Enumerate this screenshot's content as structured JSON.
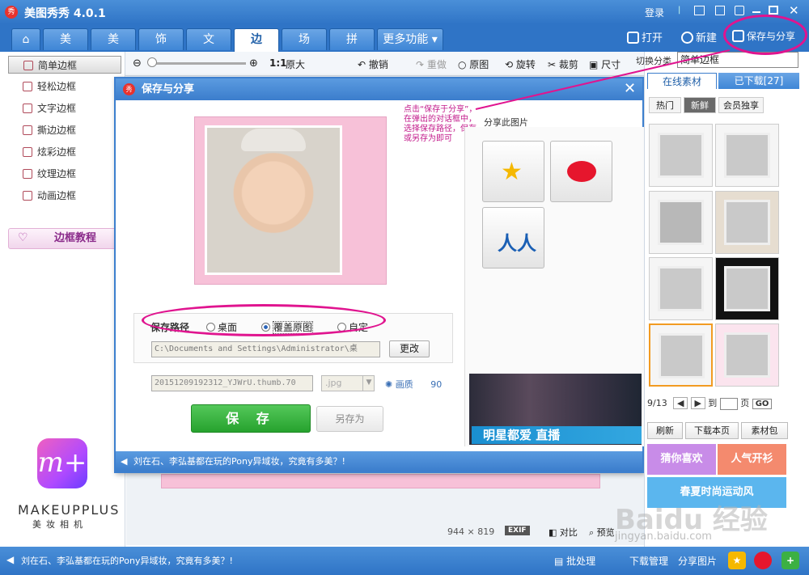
{
  "window": {
    "app_name": "美图秀秀 4.0.1",
    "login": "登录",
    "logo_char": "秀"
  },
  "main_tabs": [
    "美化",
    "美容",
    "饰品",
    "文字",
    "边框",
    "场景",
    "拼图",
    "更多功能"
  ],
  "top_actions": {
    "open": "打开",
    "new": "新建",
    "save_share": "保存与分享"
  },
  "toolbar": {
    "ratio": "1:1",
    "original_size": "原大",
    "undo": "撤销",
    "redo": "重做",
    "original": "原图",
    "rotate": "旋转",
    "crop": "裁剪",
    "size": "尺寸"
  },
  "sidebar": {
    "items": [
      "简单边框",
      "轻松边框",
      "文字边框",
      "撕边边框",
      "炫彩边框",
      "纹理边框",
      "动画边框"
    ],
    "tutorial": "边框教程"
  },
  "dialog": {
    "title": "保存与分享",
    "note": "点击“保存于分享”，在弹出的对话框中，选择保存路径，保存或另存为即可",
    "share_label": "分享此图片",
    "save_path_label": "保存路径",
    "radio_desktop": "桌面",
    "radio_overwrite": "覆盖原图",
    "radio_custom": "自定",
    "path_value": "C:\\Documents and Settings\\Administrator\\桌",
    "change_button": "更改",
    "filename": "20151209192312_YJWrU.thumb.70",
    "format": ".jpg",
    "quality_label": "画质",
    "quality_value": "90",
    "save_button": "保 存",
    "saveas_button": "另存为",
    "ad_text": "明星都爱 直播",
    "status": "刘在石、李弘基都在玩的Pony异域妆，究竟有多美？!"
  },
  "right_panel": {
    "switch_label": "切换分类",
    "category_value": "简单边框",
    "tab_online": "在线素材",
    "tab_downloaded": "已下载[27]",
    "sub_tabs": [
      "热门",
      "新鲜",
      "会员独享"
    ],
    "page_current": "9/13",
    "goto_label": "到",
    "page_unit": "页",
    "go_button": "GO",
    "refresh": "刷新",
    "download_page": "下载本页",
    "material_pack": "素材包",
    "promo1": "猜你喜欢",
    "promo2": "人气开衫",
    "promo3": "春夏时尚运动风"
  },
  "canvas": {
    "dimensions": "944 × 819",
    "exif": "EXIF",
    "compare": "对比",
    "preview": "预览"
  },
  "makeup": {
    "brand": "MAKEUPPLUS",
    "sub": "美妆相机",
    "logo_letter": "m+"
  },
  "bottom_bar": {
    "status": "刘在石、李弘基都在玩的Pony异域妆，究竟有多美？!",
    "batch": "批处理",
    "download_mgr": "下载管理",
    "share_image": "分享图片"
  },
  "watermark": {
    "main": "Baidu 经验",
    "sub": "jingyan.baidu.com"
  },
  "colors": {
    "title_blue": "#2f74c6",
    "save_green": "#26a22e",
    "annotation_magenta": "#e0148f"
  }
}
